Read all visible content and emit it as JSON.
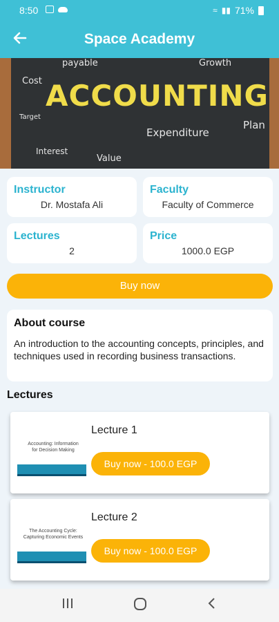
{
  "status_bar": {
    "time": "8:50",
    "battery": "71%"
  },
  "app_bar": {
    "title": "Space Academy",
    "back_icon": "arrow-left-icon"
  },
  "hero": {
    "headline": "ACCOUNTING",
    "words": [
      "payable",
      "Growth",
      "Cost",
      "Target",
      "Expenditure",
      "Plan",
      "Interest",
      "Value"
    ]
  },
  "info": {
    "instructor": {
      "label": "Instructor",
      "value": "Dr. Mostafa Ali"
    },
    "faculty": {
      "label": "Faculty",
      "value": "Faculty of Commerce"
    },
    "lectures": {
      "label": "Lectures",
      "value": "2"
    },
    "price": {
      "label": "Price",
      "value": "1000.0 EGP"
    }
  },
  "buy_now_label": "Buy now",
  "about": {
    "heading": "About course",
    "text": "An introduction to the accounting concepts, principles, and techniques used in recording business transactions."
  },
  "lectures_heading": "Lectures",
  "lectures": [
    {
      "name": "Lecture 1",
      "button": "Buy now - 100.0 EGP",
      "thumb_lines": [
        "Accounting: Information",
        "for Decision Making"
      ]
    },
    {
      "name": "Lecture 2",
      "button": "Buy now - 100.0 EGP",
      "thumb_lines": [
        "The Accounting Cycle:",
        "Capturing Economic Events"
      ]
    }
  ],
  "colors": {
    "primary": "#3fc0d6",
    "accent": "#fbb308",
    "label": "#2bb3cf"
  }
}
